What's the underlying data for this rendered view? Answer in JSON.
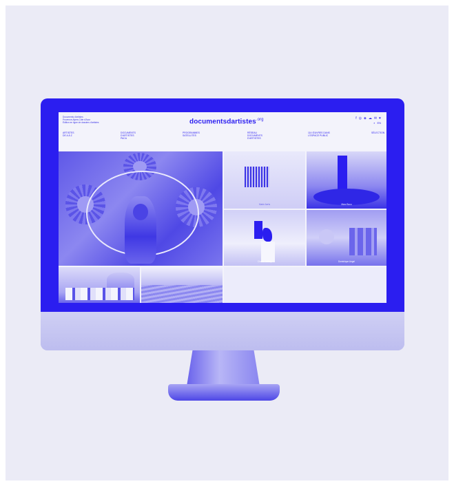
{
  "site": {
    "org_lines": [
      "Documents d'artistes",
      "Provence-Alpes-Côte d'Azur",
      "Édition en ligne de dossiers d'artistes"
    ],
    "logo_text": "documentsdartistes",
    "logo_suffix": ".org",
    "social_icons": [
      "facebook-icon",
      "instagram-icon",
      "vimeo-icon",
      "soundcloud-icon",
      "newsletter-icon",
      "heart-icon"
    ],
    "social_glyphs": [
      "f",
      "◎",
      "◈",
      "☁",
      "✉",
      "♥"
    ],
    "search_glyph": "⌕",
    "lang_label": "EN"
  },
  "nav": [
    {
      "label": "ARTISTES\nDE A À Z"
    },
    {
      "label": "DOCUMENTS\nD'ARTISTES\nPACA"
    },
    {
      "label": "PROGRAMMES\nSATELLITES"
    },
    {
      "label": "RÉSEAU\nDOCUMENTS\nD'ARTISTES"
    },
    {
      "label": "114 ŒUVRES DANS\nL'ESPACE PUBLIC"
    },
    {
      "label": "SÉLECTION"
    }
  ],
  "tiles": {
    "a": {
      "caption": "Marie Aerts"
    },
    "b": {
      "caption": "Marc Boco"
    },
    "c": {
      "caption": "Charlie Jeffery"
    },
    "d": {
      "caption": "Dominique Angel"
    }
  },
  "colors": {
    "accent": "#2b1ef0",
    "background": "#ebebf6",
    "screen": "#f3f3fb"
  }
}
